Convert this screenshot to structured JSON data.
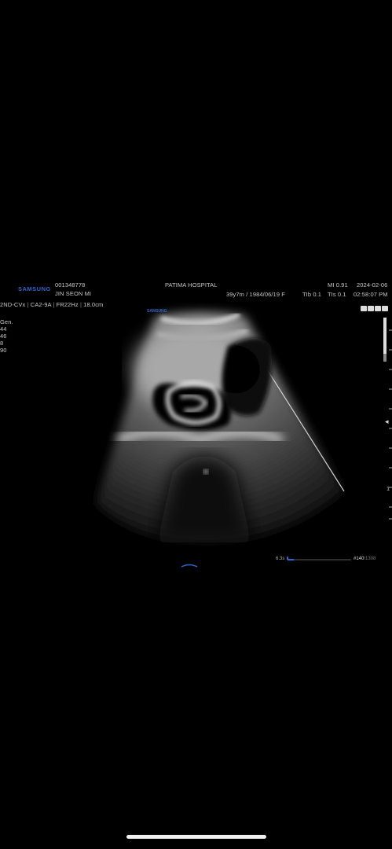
{
  "header": {
    "brand": "SAMSUNG",
    "patient_id": "001348778",
    "patient_name": "JIN SEON MI",
    "hospital": "PATIMA HOSPITAL",
    "patient_info": "39y7m / 1984/06/19  F",
    "mi": "MI  0.91",
    "tib": "TIb 0.1",
    "tis": "TIs 0.1",
    "date": "2024-02-06",
    "time": "02:58:07 PM"
  },
  "probe_line": {
    "mode": "2ND-CVx",
    "probe": "CA2-9A",
    "frame_rate": "FR22Hz",
    "depth": "18.0cm"
  },
  "params": [
    "Gen.",
    "44",
    "46",
    "8",
    "90"
  ],
  "image_logo": "SAMSUNG",
  "cine": {
    "time": "6.3s",
    "frame": "#140",
    "total": "/1308"
  },
  "side_marks": {
    "focus": "◂",
    "depth_label": "1"
  },
  "colors": {
    "brand_blue": "#2d66c8",
    "text": "#c8c8c8",
    "background": "#000000"
  }
}
